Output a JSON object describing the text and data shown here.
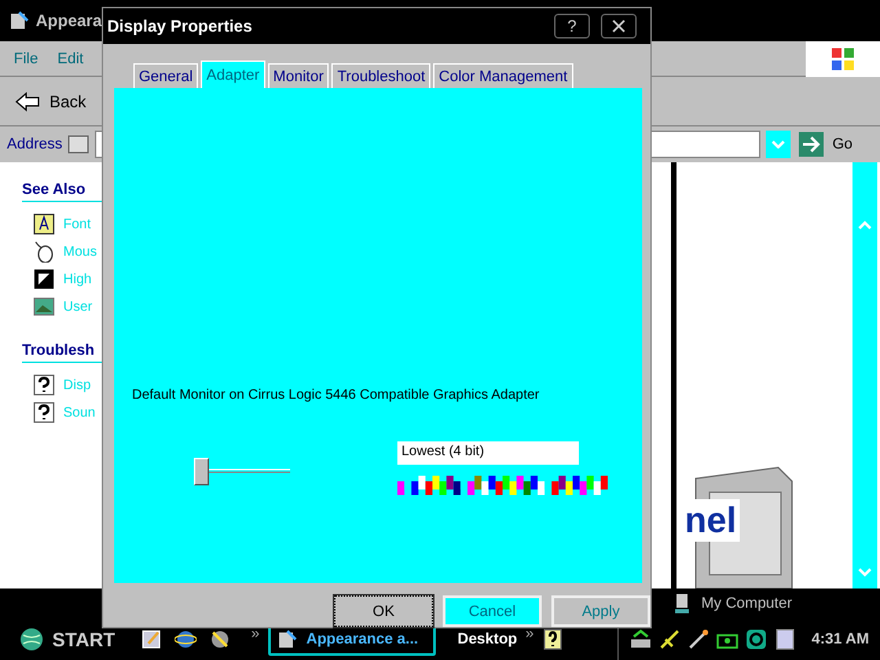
{
  "background_window": {
    "title": "Appeara",
    "menu": [
      "File",
      "Edit"
    ],
    "back": "Back",
    "address_label": "Address",
    "go": "Go",
    "sidebar": [
      {
        "heading": "See Also",
        "items": [
          {
            "label": "Font",
            "kind": "font"
          },
          {
            "label": "Mous",
            "kind": "mouse"
          },
          {
            "label": "High",
            "kind": "contrast"
          },
          {
            "label": "User",
            "kind": "picture"
          }
        ]
      },
      {
        "heading": "Troublesh",
        "items": [
          {
            "label": "Disp",
            "kind": "help"
          },
          {
            "label": "Soun",
            "kind": "help"
          }
        ]
      }
    ],
    "banner": "nel",
    "status": "My Computer"
  },
  "dialog": {
    "title": "Display Properties",
    "help_button": "?",
    "tabs": [
      {
        "label": "General",
        "selected": false
      },
      {
        "label": "Adapter",
        "selected": true
      },
      {
        "label": "Monitor",
        "selected": false
      },
      {
        "label": "Troubleshoot",
        "selected": false
      },
      {
        "label": "Color Management",
        "selected": false
      }
    ],
    "adapter_label": "Default Monitor on Cirrus Logic 5446 Compatible Graphics Adapter",
    "slider": {
      "level": 0
    },
    "color_quality": "Lowest (4 bit)",
    "buttons": [
      {
        "label": "OK",
        "focused": true
      },
      {
        "label": "Cancel",
        "focused": false
      },
      {
        "label": "Apply",
        "focused": false
      }
    ]
  },
  "taskbar": {
    "start": "START",
    "quick_launch_more": "»",
    "tasks": [
      {
        "label": "Appearance a...",
        "selected": true
      }
    ],
    "desktop_toolbar": "Desktop",
    "toolbar_more": "»",
    "clock": "4:31 AM"
  }
}
